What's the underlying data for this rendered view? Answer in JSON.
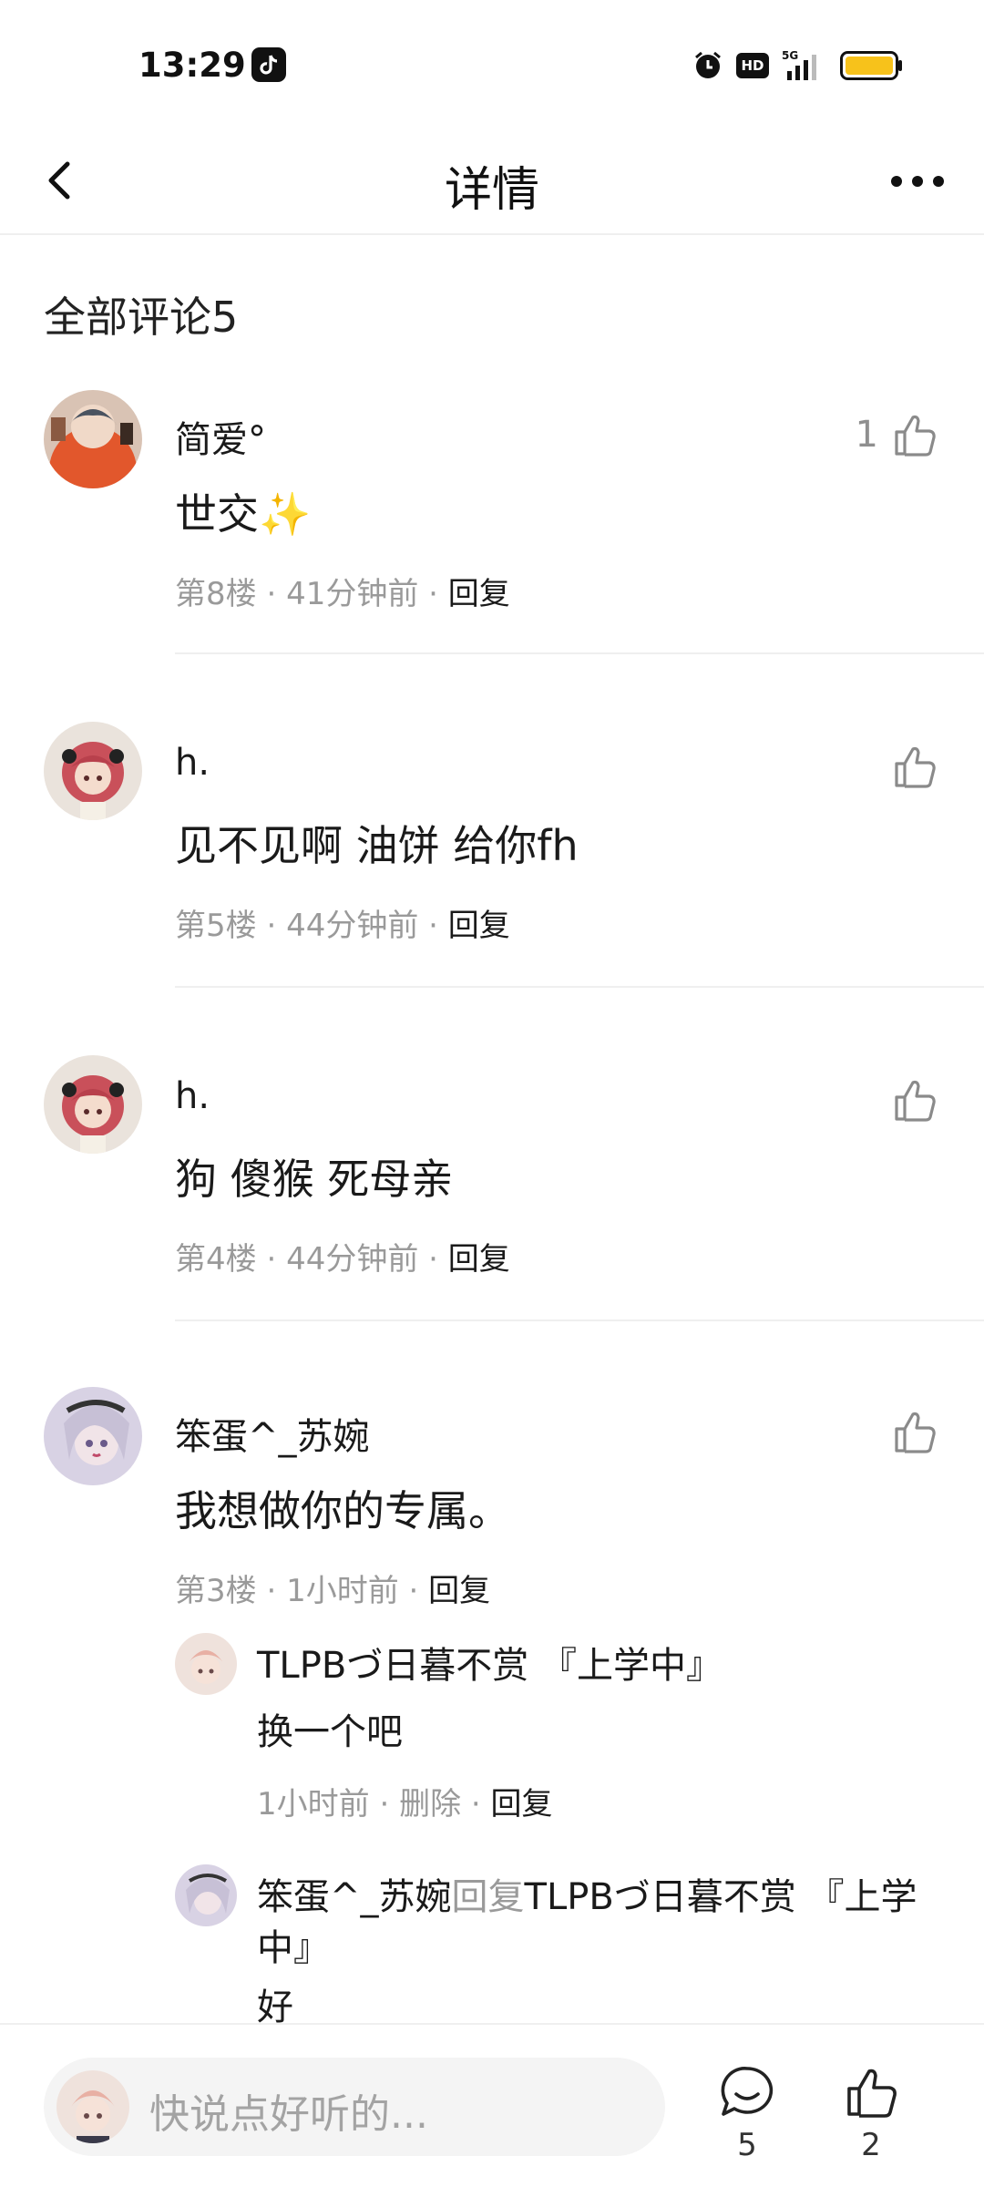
{
  "status": {
    "time": "13:29",
    "hd": "HD",
    "network": "5G"
  },
  "nav": {
    "title": "详情"
  },
  "comments_header": "全部评论5",
  "comments": [
    {
      "name": "简爱°",
      "body": "世交✨",
      "floor": "第8楼",
      "time": "41分钟前",
      "reply": "回复",
      "likes": "1"
    },
    {
      "name": "h.",
      "body": "见不见啊 油饼 给你fh",
      "floor": "第5楼",
      "time": "44分钟前",
      "reply": "回复",
      "likes": ""
    },
    {
      "name": "h.",
      "body": "狗 傻猴 死母亲",
      "floor": "第4楼",
      "time": "44分钟前",
      "reply": "回复",
      "likes": ""
    },
    {
      "name": "笨蛋^_苏婉",
      "body": "我想做你的专属。",
      "floor": "第3楼",
      "time": "1小时前",
      "reply": "回复",
      "likes": ""
    }
  ],
  "subreplies": [
    {
      "name": "TLPBづ日暮不赏 『上学中』",
      "body": "换一个吧",
      "time": "1小时前",
      "delete": "删除",
      "reply": "回复"
    },
    {
      "name": "笨蛋^_苏婉",
      "reply_word": "回复",
      "target": "TLPBづ日暮不赏 『上学中』",
      "body": "好"
    }
  ],
  "bottom": {
    "placeholder": "快说点好听的...",
    "comment_count": "5",
    "like_count": "2"
  },
  "colors": {
    "battery": "#f7c21b",
    "meta_grey": "#9a9a9a"
  }
}
